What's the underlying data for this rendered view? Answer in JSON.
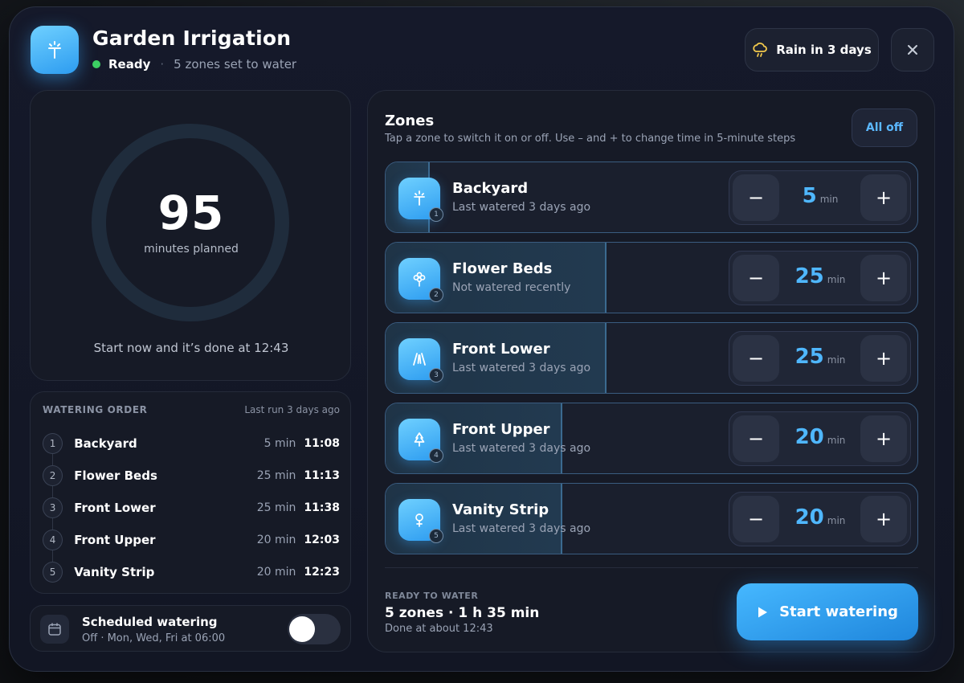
{
  "header": {
    "title": "Garden Irrigation",
    "status": "Ready",
    "status_separator": "·",
    "status_detail": "5 zones set to water",
    "rain_chip": "Rain in 3 days",
    "close_label": "✕"
  },
  "summary": {
    "minutes": "95",
    "minutes_caption": "minutes planned",
    "done_text": "Start now and it’s done at 12:43"
  },
  "order": {
    "title": "WATERING ORDER",
    "last_run": "Last run 3 days ago",
    "items": [
      {
        "num": "1",
        "name": "Backyard",
        "duration": "5 min",
        "time": "11:08"
      },
      {
        "num": "2",
        "name": "Flower Beds",
        "duration": "25 min",
        "time": "11:13"
      },
      {
        "num": "3",
        "name": "Front Lower",
        "duration": "25 min",
        "time": "11:38"
      },
      {
        "num": "4",
        "name": "Front Upper",
        "duration": "20 min",
        "time": "12:03"
      },
      {
        "num": "5",
        "name": "Vanity Strip",
        "duration": "20 min",
        "time": "12:23"
      }
    ]
  },
  "schedule": {
    "title": "Scheduled watering",
    "detail": "Off · Mon, Wed, Fri at 06:00",
    "enabled": false
  },
  "zones": {
    "title": "Zones",
    "subtitle": "Tap a zone to switch it on or off. Use – and + to change time in 5-minute steps",
    "all_off": "All off",
    "minus": "−",
    "plus": "+",
    "unit": "min",
    "items": [
      {
        "num": "1",
        "name": "Backyard",
        "sub": "Last watered 3 days ago",
        "minutes": "5",
        "icon": "sprinkler-icon"
      },
      {
        "num": "2",
        "name": "Flower Beds",
        "sub": "Not watered recently",
        "minutes": "25",
        "icon": "flower-icon"
      },
      {
        "num": "3",
        "name": "Front Lower",
        "sub": "Last watered 3 days ago",
        "minutes": "25",
        "icon": "path-icon"
      },
      {
        "num": "4",
        "name": "Front Upper",
        "sub": "Last watered 3 days ago",
        "minutes": "20",
        "icon": "tree-icon"
      },
      {
        "num": "5",
        "name": "Vanity Strip",
        "sub": "Last watered 3 days ago",
        "minutes": "20",
        "icon": "plant-icon"
      }
    ]
  },
  "footer": {
    "label": "READY TO WATER",
    "main": "5 zones · 1 h 35 min",
    "sub": "Done at about 12:43",
    "start": "Start watering"
  },
  "colors": {
    "accent": "#4fb7ff",
    "status_ready": "#3ccf63",
    "rain_icon": "#f2c94c"
  }
}
